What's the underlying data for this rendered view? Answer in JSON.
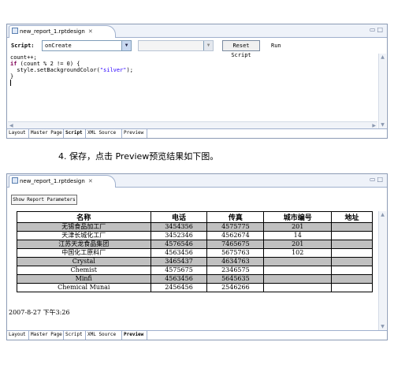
{
  "top_editor": {
    "tab_title": "new_report_1.rptdesign",
    "script_label": "Script:",
    "event_selected": "onCreate",
    "reset_label": "Reset Script",
    "run_label": "Run",
    "code_lines": [
      "count++;",
      "if (count % 2 != 0) {",
      "  style.setBackgroundColor(\"silver\");",
      "}",
      ""
    ],
    "bottom_tabs": [
      "Layout",
      "Master Page",
      "Script",
      "XML Source",
      "Preview"
    ],
    "active_tab": "Script"
  },
  "caption": "4.   保存，点击 Preview预览结果如下图。",
  "bottom_editor": {
    "tab_title": "new_report_1.rptdesign",
    "show_params_label": "Show Report Parameters",
    "table": {
      "headers": [
        "名称",
        "电话",
        "传真",
        "城市编号",
        "地址"
      ],
      "rows": [
        [
          "无锡食品加工厂",
          "3454356",
          "4575775",
          "201",
          ""
        ],
        [
          "天津长城化工厂",
          "3452346",
          "4562674",
          "14",
          ""
        ],
        [
          "江苏天龙食品集团",
          "4576546",
          "7465675",
          "201",
          ""
        ],
        [
          "中国化工原料厂",
          "4563456",
          "5675763",
          "102",
          ""
        ],
        [
          "Crystal",
          "3465437",
          "4634763",
          "",
          ""
        ],
        [
          "Chemist",
          "4575675",
          "2346575",
          "",
          ""
        ],
        [
          "Minfi",
          "4563456",
          "5645635",
          "",
          ""
        ],
        [
          "Chemical Munai",
          "2456456",
          "2546266",
          "",
          ""
        ]
      ]
    },
    "timestamp": "2007-8-27 下午3:26",
    "bottom_tabs": [
      "Layout",
      "Master Page",
      "Script",
      "XML Source",
      "Preview"
    ],
    "active_tab": "Preview"
  },
  "colors": {
    "row_highlight": "#c0c0c0",
    "keyword": "#7f0055",
    "string": "#2a00ff"
  }
}
